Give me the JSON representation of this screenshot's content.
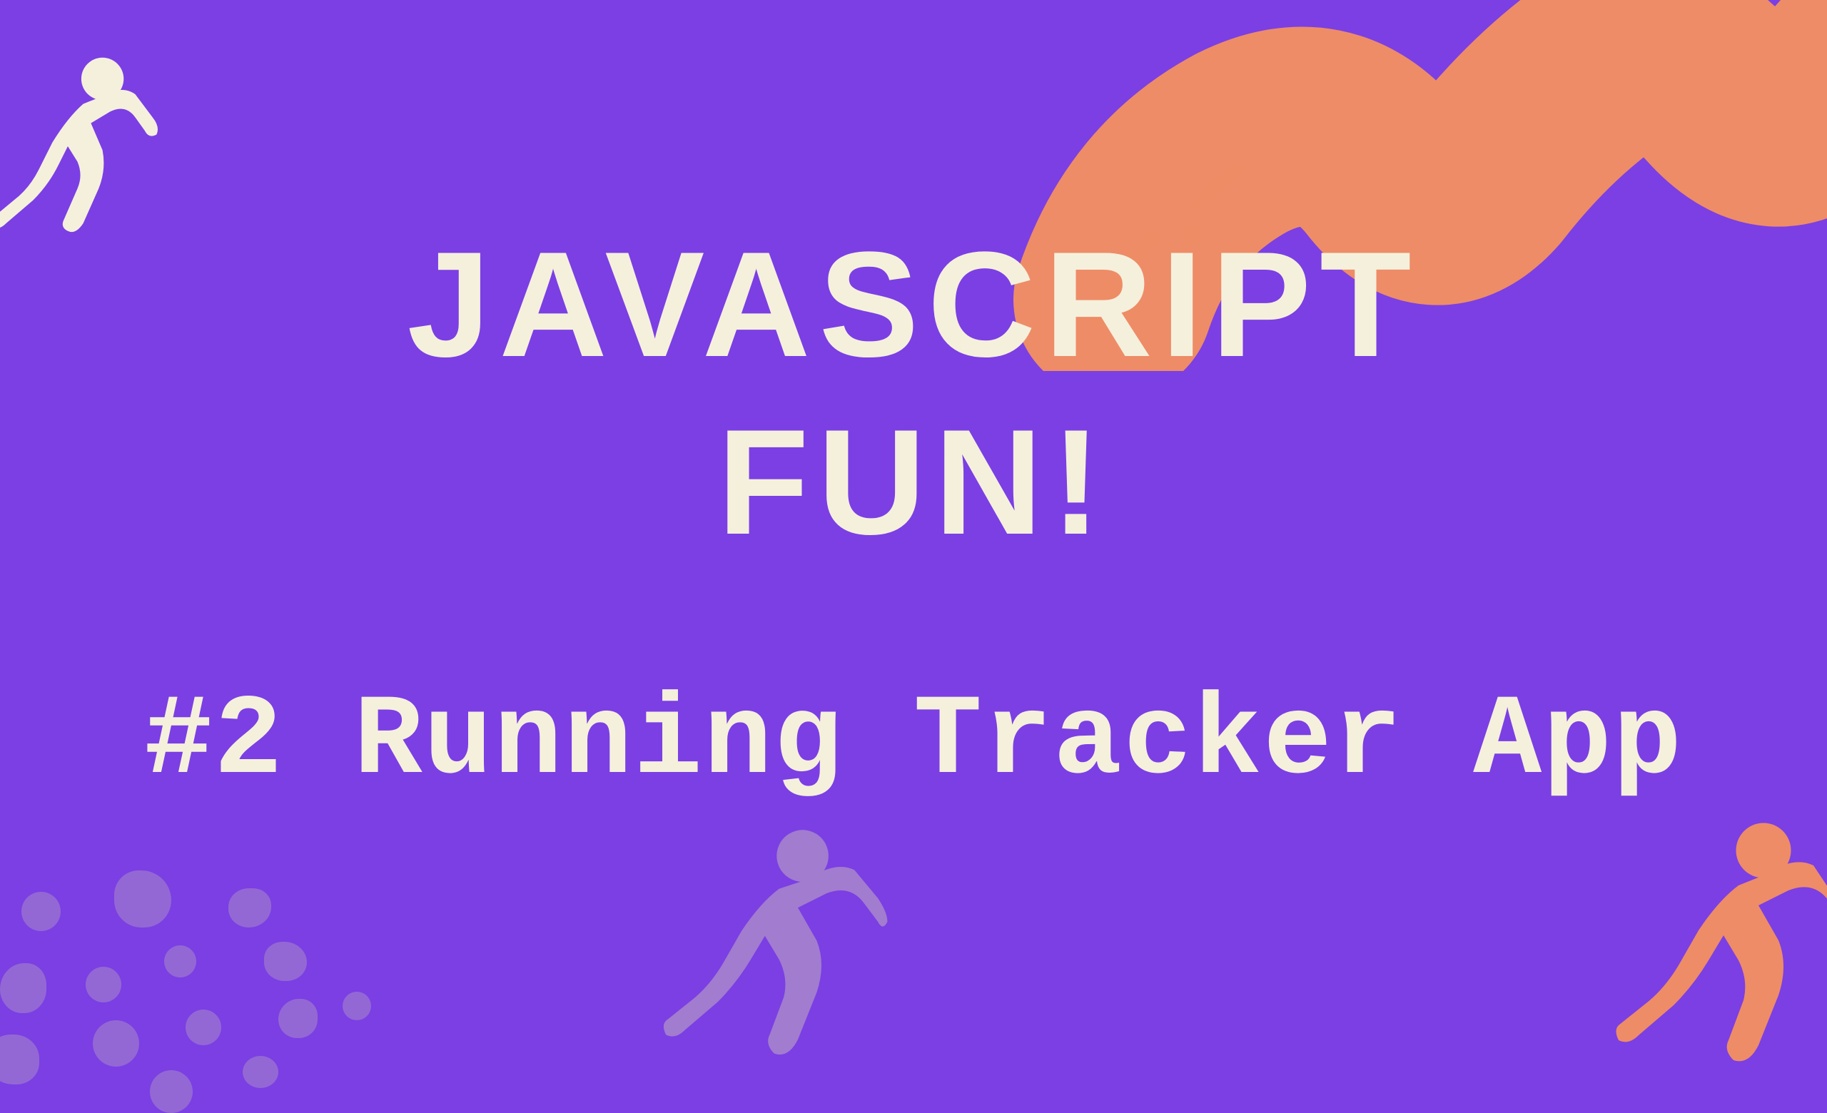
{
  "title_line1": "JAVASCRIPT",
  "title_line2": "FUN!",
  "subtitle": "#2 Running Tracker App",
  "colors": {
    "background": "#7B3FE4",
    "text": "#F5F0DC",
    "accent_orange": "#EE8C67",
    "accent_lilac": "#A27CCE",
    "dots": "#9368D4"
  }
}
